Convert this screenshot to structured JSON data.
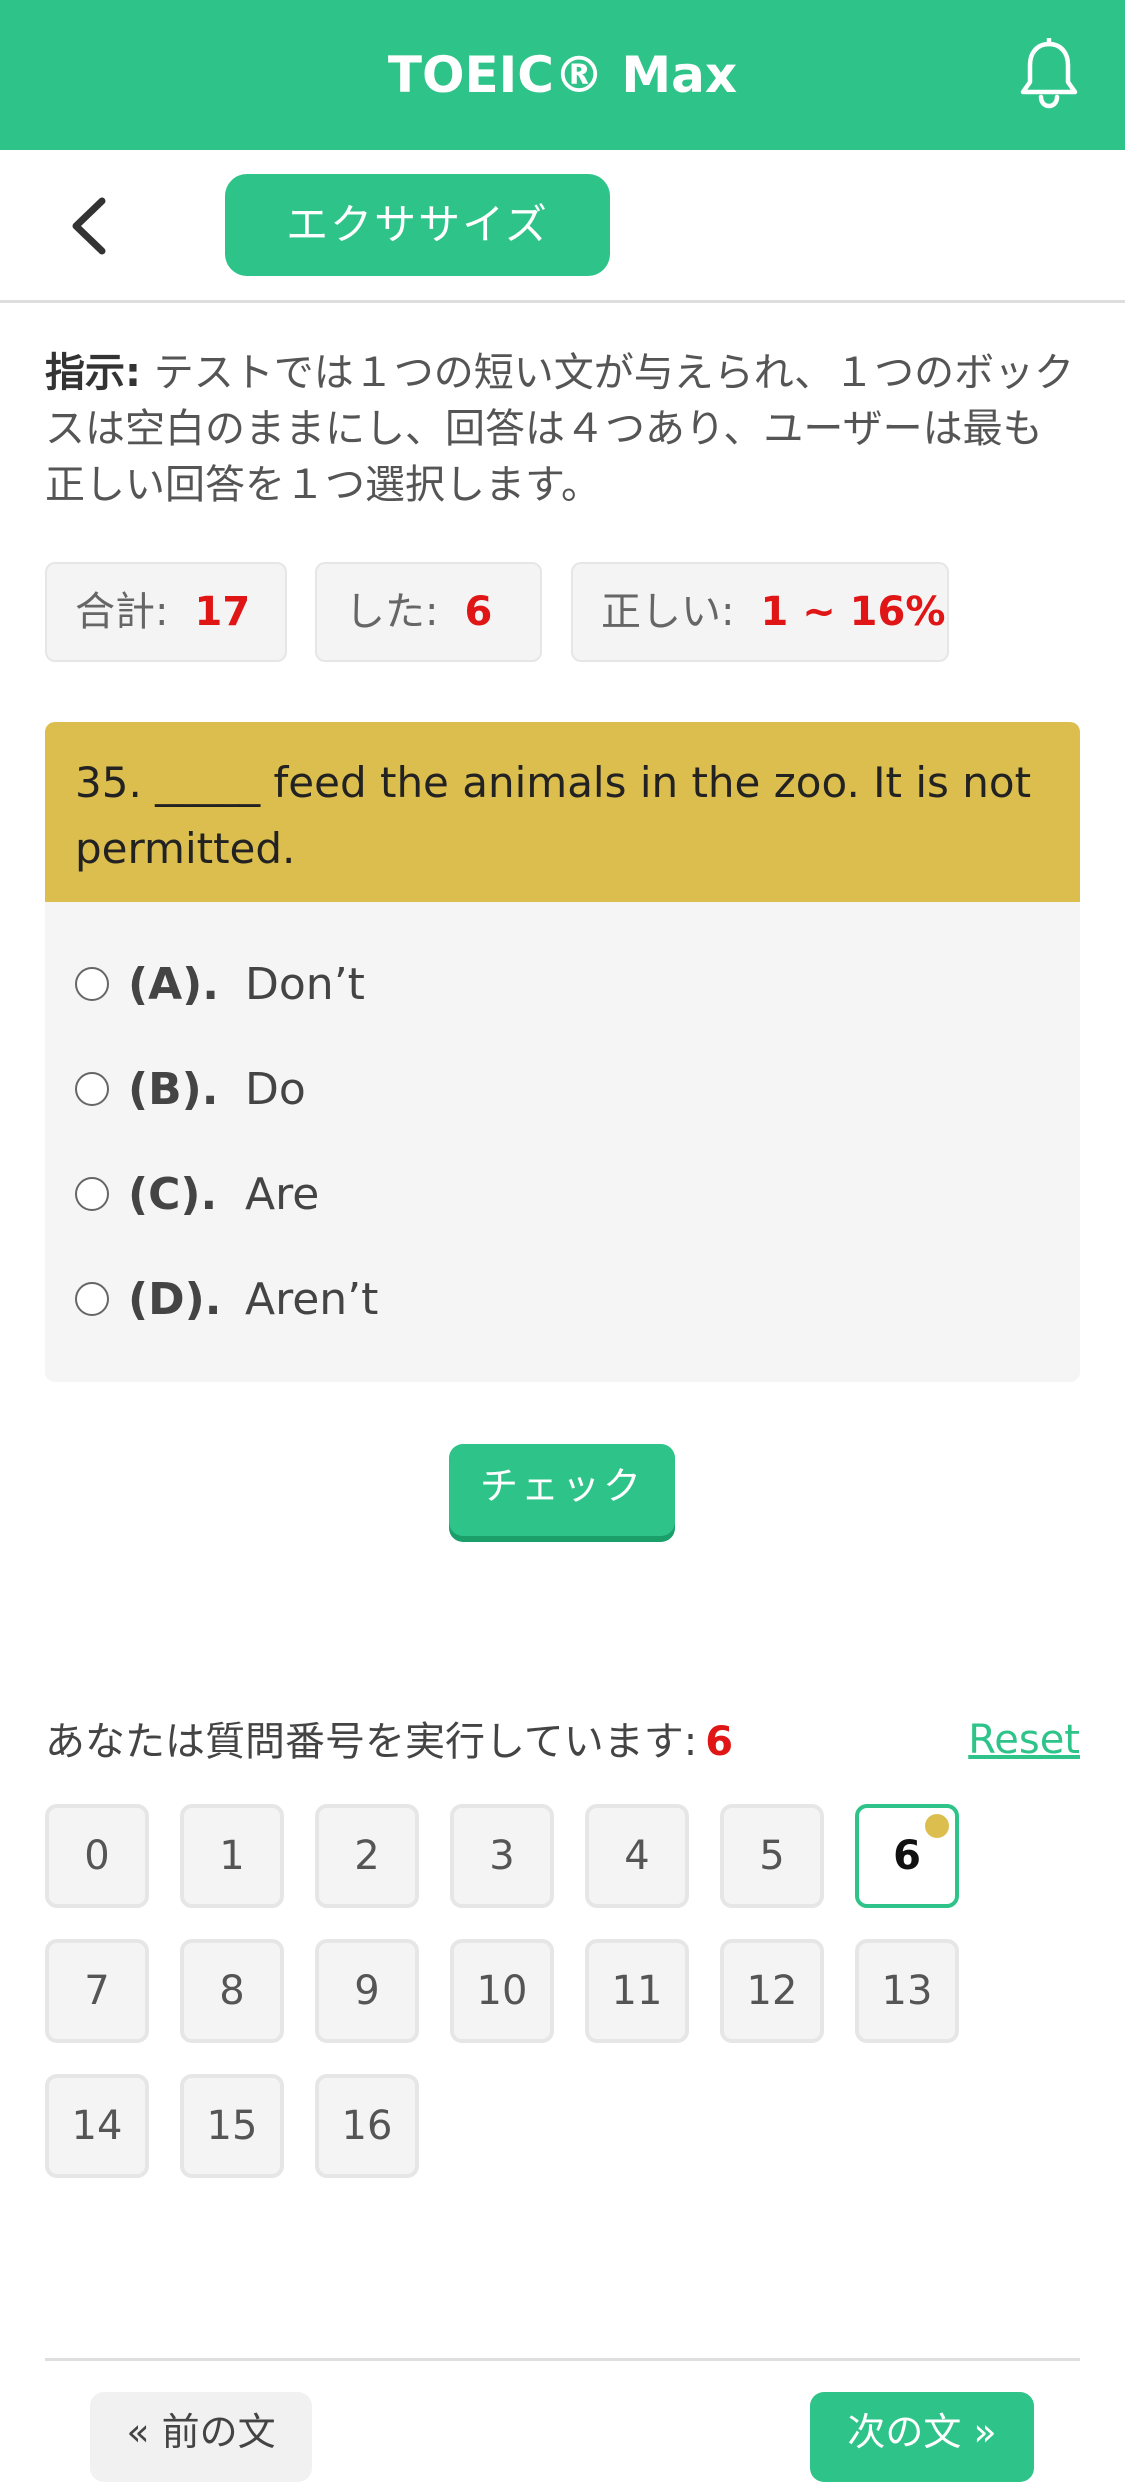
{
  "header": {
    "title": "TOEIC® Max",
    "notification_icon": "bell-icon"
  },
  "subnav": {
    "back_icon": "chevron-left-icon",
    "tab_label": "エクササイズ"
  },
  "instruction": {
    "label": "指示:",
    "text": " テストでは１つの短い文が与えられ、１つのボックスは空白のままにし、回答は４つあり、ユーザーは最も正しい回答を１つ選択します。"
  },
  "stats": {
    "total_label": "合計:",
    "total_value": "17",
    "done_label": "した:",
    "done_value": "6",
    "correct_label": "正しい:",
    "correct_value": "1 ~ 16%"
  },
  "question": {
    "text": "35. _____ feed the animals in the zoo. It is not permitted.",
    "options": [
      {
        "letter": "(A).",
        "text": "Don’t"
      },
      {
        "letter": "(B).",
        "text": "Do"
      },
      {
        "letter": "(C).",
        "text": "Are"
      },
      {
        "letter": "(D).",
        "text": "Aren’t"
      }
    ]
  },
  "check_button": "チェック",
  "progress": {
    "label": "あなたは質問番号を実行しています:",
    "current": "6",
    "reset_label": "Reset",
    "numbers": [
      "0",
      "1",
      "2",
      "3",
      "4",
      "5",
      "6",
      "7",
      "8",
      "9",
      "10",
      "11",
      "12",
      "13",
      "14",
      "15",
      "16"
    ],
    "active_index": 6
  },
  "nav": {
    "prev_label": "« 前の文",
    "next_label": "次の文 »"
  },
  "colors": {
    "brand_green": "#2ec489",
    "question_header": "#dcbe4e",
    "accent_red": "#e01515"
  }
}
